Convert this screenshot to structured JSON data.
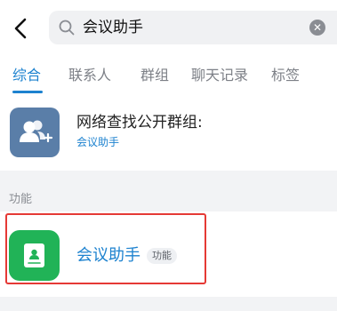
{
  "search": {
    "query": "会议助手",
    "search_icon": "search-icon",
    "clear_icon": "clear-icon"
  },
  "nav": {
    "back_icon": "chevron-left-icon"
  },
  "tabs": [
    {
      "label": "综合",
      "active": true
    },
    {
      "label": "联系人",
      "active": false
    },
    {
      "label": "群组",
      "active": false
    },
    {
      "label": "聊天记录",
      "active": false
    },
    {
      "label": "标签",
      "active": false
    }
  ],
  "group_search": {
    "title": "网络查找公开群组:",
    "subtitle": "会议助手",
    "icon": "group-add-icon"
  },
  "section": {
    "label": "功能"
  },
  "feature": {
    "name": "会议助手",
    "badge": "功能",
    "icon": "meeting-assistant-icon"
  },
  "colors": {
    "accent": "#1d82cf",
    "highlight": "#e53935",
    "feature_icon_bg": "#21b357",
    "group_icon_bg": "#5a7ea8"
  }
}
